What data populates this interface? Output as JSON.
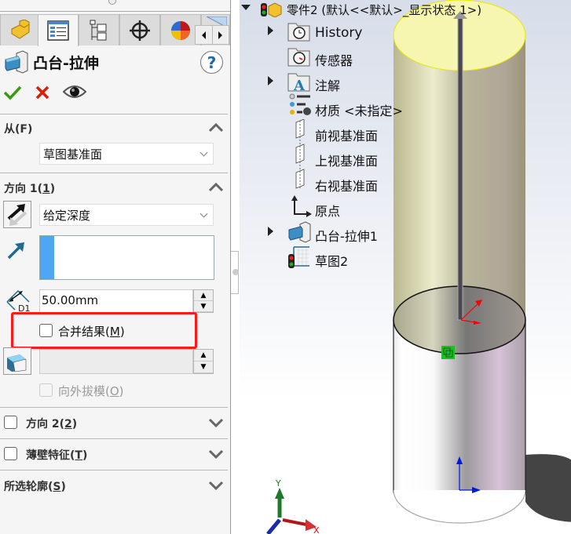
{
  "panel": {
    "tabs": [
      {
        "icon": "feature-manager-icon"
      },
      {
        "icon": "property-manager-icon"
      },
      {
        "icon": "configuration-manager-icon"
      },
      {
        "icon": "dimxpert-icon"
      },
      {
        "icon": "display-manager-icon"
      },
      {
        "icon": "more-tabs-icon"
      }
    ],
    "title": "凸台-拉伸",
    "help": "?",
    "from": {
      "header": "从(F)",
      "hotkey": "F",
      "header_prefix": "从(",
      "header_suffix": ")",
      "value": "草图基准面"
    },
    "direction1": {
      "header_prefix": "方向 1(",
      "hotkey": "1",
      "header_suffix": ")",
      "end_condition": "给定深度",
      "depth": "50.00mm",
      "dim_label": "D1",
      "merge_prefix": "合并结果(",
      "merge_hotkey": "M",
      "merge_suffix": ")",
      "merge_checked": false,
      "draft_value": "",
      "draft_out_prefix": "向外拔模(",
      "draft_out_hotkey": "O",
      "draft_out_suffix": ")",
      "draft_out_checked": false
    },
    "direction2": {
      "prefix": "方向 2(",
      "hotkey": "2",
      "suffix": ")",
      "checked": false
    },
    "thin": {
      "prefix": "薄壁特征(",
      "hotkey": "T",
      "suffix": ")",
      "checked": false
    },
    "contours": {
      "prefix": "所选轮廓(",
      "hotkey": "S",
      "suffix": ")"
    },
    "highlight_color": "#ff1a1a",
    "accent_color": "#4ea6f5"
  },
  "tree": {
    "root": "零件2  (默认<<默认>_显示状态 1>)",
    "items": [
      {
        "label": "History",
        "icon": "history-folder-icon",
        "expandable": true
      },
      {
        "label": "传感器",
        "icon": "sensor-folder-icon",
        "expandable": false
      },
      {
        "label": "注解",
        "icon": "annotation-folder-icon",
        "expandable": true
      },
      {
        "label": "材质 <未指定>",
        "icon": "material-icon",
        "expandable": false
      },
      {
        "label": "前视基准面",
        "icon": "plane-icon",
        "expandable": false
      },
      {
        "label": "上视基准面",
        "icon": "plane-icon",
        "expandable": false
      },
      {
        "label": "右视基准面",
        "icon": "plane-icon",
        "expandable": false
      },
      {
        "label": "原点",
        "icon": "origin-icon",
        "expandable": false
      },
      {
        "label": "凸台-拉伸1",
        "icon": "extrude-icon",
        "expandable": true
      },
      {
        "label": "草图2",
        "icon": "sketch-icon",
        "expandable": false
      }
    ]
  },
  "triad": {
    "x": "X",
    "y": "Y"
  }
}
